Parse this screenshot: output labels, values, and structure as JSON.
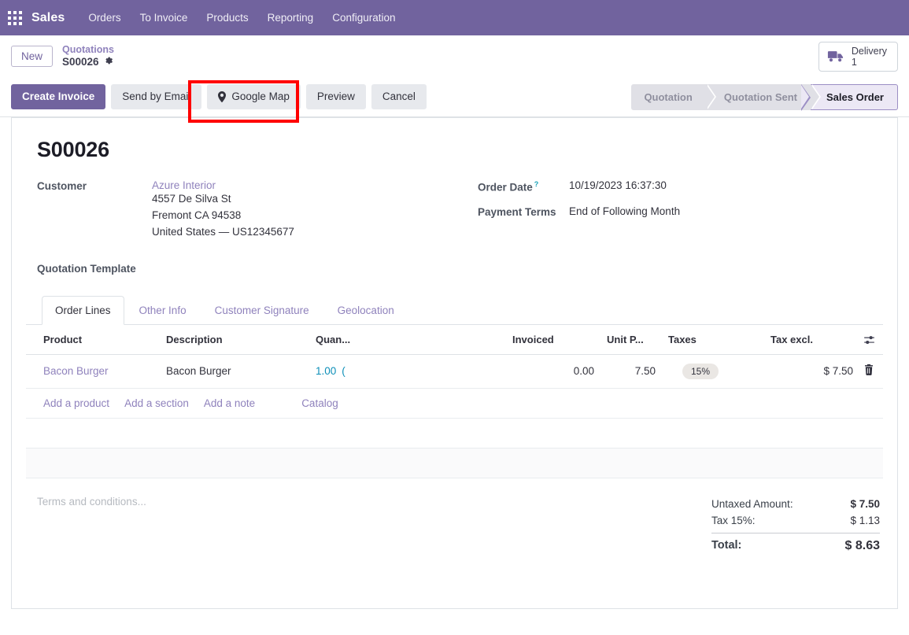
{
  "navbar": {
    "apps_icon": "apps-grid-icon",
    "brand": "Sales",
    "menus": [
      "Orders",
      "To Invoice",
      "Products",
      "Reporting",
      "Configuration"
    ]
  },
  "control_panel": {
    "new_button": "New",
    "breadcrumb_parent": "Quotations",
    "breadcrumb_current": "S00026",
    "gear_icon": "gear-icon",
    "stat_button": {
      "icon": "truck-icon",
      "label": "Delivery",
      "value": "1"
    },
    "buttons": [
      {
        "label": "Create Invoice",
        "style": "primary",
        "icon": null
      },
      {
        "label": "Send by Email",
        "style": "secondary",
        "icon": null
      },
      {
        "label": "Google Map",
        "style": "secondary",
        "icon": "map-pin-icon",
        "highlighted": true
      },
      {
        "label": "Preview",
        "style": "secondary",
        "icon": null
      },
      {
        "label": "Cancel",
        "style": "secondary",
        "icon": null
      }
    ],
    "statusbar": [
      {
        "label": "Quotation",
        "active": false
      },
      {
        "label": "Quotation Sent",
        "active": false
      },
      {
        "label": "Sales Order",
        "active": true
      }
    ]
  },
  "record": {
    "title": "S00026",
    "customer_label": "Customer",
    "customer_name": "Azure Interior",
    "customer_address": [
      "4557 De Silva St",
      "Fremont CA 94538",
      "United States — US12345677"
    ],
    "quotation_template_label": "Quotation Template",
    "quotation_template_value": "",
    "order_date_label": "Order Date",
    "order_date_help_icon": "help-question-icon",
    "order_date_value": "10/19/2023 16:37:30",
    "payment_terms_label": "Payment Terms",
    "payment_terms_value": "End of Following Month"
  },
  "notebook": {
    "tabs": [
      {
        "label": "Order Lines",
        "active": true
      },
      {
        "label": "Other Info",
        "active": false
      },
      {
        "label": "Customer Signature",
        "active": false
      },
      {
        "label": "Geolocation",
        "active": false
      }
    ]
  },
  "order_lines": {
    "columns": [
      "Product",
      "Description",
      "Quan...",
      "Invoiced",
      "Unit P...",
      "Taxes",
      "Tax excl."
    ],
    "optional_columns_icon": "sliders-adjust-icon",
    "rows": [
      {
        "product": "Bacon Burger",
        "description": "Bacon Burger",
        "quantity": "1.00",
        "uom_fragment": "(",
        "invoiced": "0.00",
        "unit_price": "7.50",
        "taxes": "15%",
        "tax_excl": "$ 7.50",
        "delete_icon": "trash-icon"
      }
    ],
    "add_links": [
      {
        "label": "Add a product",
        "group": "left"
      },
      {
        "label": "Add a section",
        "group": "left"
      },
      {
        "label": "Add a note",
        "group": "left"
      },
      {
        "label": "Catalog",
        "group": "right"
      }
    ]
  },
  "footer": {
    "terms_placeholder": "Terms and conditions...",
    "totals": [
      {
        "label": "Untaxed Amount:",
        "value": "$ 7.50",
        "kind": "untaxed"
      },
      {
        "label": "Tax 15%:",
        "value": "$ 1.13",
        "kind": "tax"
      },
      {
        "label": "Total:",
        "value": "$ 8.63",
        "kind": "grand"
      }
    ]
  },
  "colors": {
    "brand_purple": "#71639e",
    "link_purple": "#8f82bc",
    "teal_value": "#0d8fb8",
    "annotation_red": "#ff0000",
    "status_inactive_bg": "#e0e0e6",
    "status_active_bg": "#ece8f5",
    "tax_pill_bg": "#eae7e4"
  }
}
